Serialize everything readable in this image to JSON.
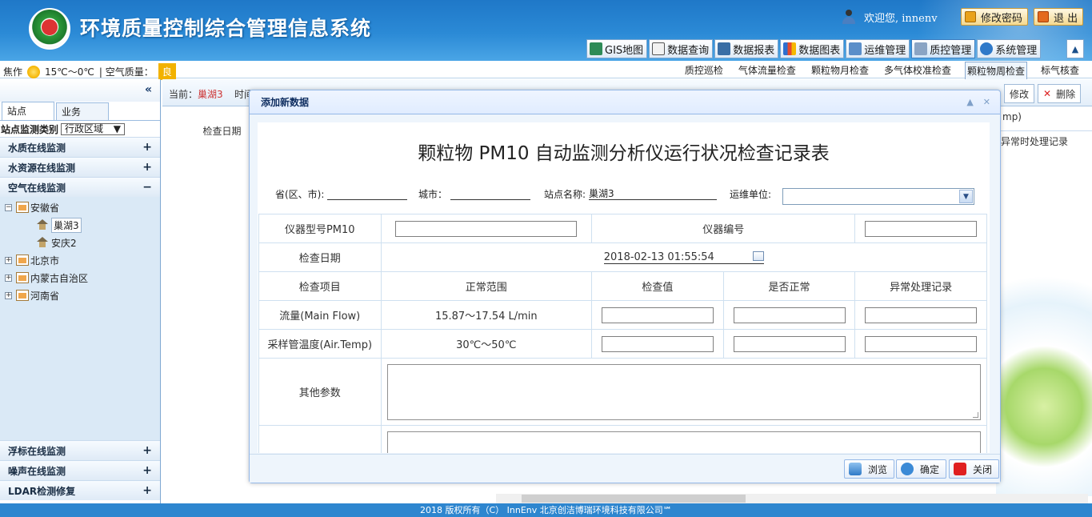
{
  "app": {
    "title": "环境质量控制综合管理信息系统",
    "welcome": "欢迎您, innenv",
    "change_password": "修改密码",
    "logout": "退 出"
  },
  "main_nav": [
    {
      "label": "GIS地图",
      "icon": "map-icon"
    },
    {
      "label": "数据查询",
      "icon": "search-doc-icon"
    },
    {
      "label": "数据报表",
      "icon": "report-icon"
    },
    {
      "label": "数据图表",
      "icon": "chart-icon"
    },
    {
      "label": "运维管理",
      "icon": "maintenance-icon"
    },
    {
      "label": "质控管理",
      "icon": "tools-icon",
      "active": true
    },
    {
      "label": "系统管理",
      "icon": "gear-icon"
    }
  ],
  "weather": {
    "city": "焦作",
    "temp": "15℃～0℃",
    "aq_label": "| 空气质量：",
    "aq_value": "良",
    "aq_color": "#f2b200"
  },
  "sub_nav": [
    "质控巡检",
    "气体流量检查",
    "颗粒物月检查",
    "多气体校准检查",
    "颗粒物周检查",
    "标气核查"
  ],
  "sub_nav_active": "颗粒物周检查",
  "sidebar": {
    "collapse": "«",
    "tabs": [
      "站点",
      "业务"
    ],
    "filter_label": "站点监测类别",
    "filter_value": "行政区域",
    "sections_top": [
      {
        "label": "水质在线监测",
        "sign": "+"
      },
      {
        "label": "水资源在线监测",
        "sign": "+"
      },
      {
        "label": "空气在线监测",
        "sign": "−"
      }
    ],
    "tree": {
      "anhui": "安徽省",
      "chaohu": "巢湖3",
      "anqing": "安庆2",
      "beijing": "北京市",
      "neimenggu": "内蒙古自治区",
      "henan": "河南省"
    },
    "sections_bottom": [
      {
        "label": "浮标在线监测",
        "sign": "+"
      },
      {
        "label": "噪声在线监测",
        "sign": "+"
      },
      {
        "label": "LDAR检测修复",
        "sign": "+"
      }
    ]
  },
  "content": {
    "current_label": "当前：",
    "current_station": "巢湖3",
    "time_label": "时间",
    "edit": "修改",
    "delete": "删除",
    "col_check_date": "检查日期",
    "col_mp": "mp)",
    "col_abnormal": "异常时处理记录"
  },
  "dialog": {
    "title": "添加新数据",
    "form_title": "颗粒物 PM10 自动监测分析仪运行状况检查记录表",
    "province_label": "省(区、市):",
    "city_label": "城市：",
    "station_label": "站点名称:",
    "station_value": "巢湖3",
    "unit_label": "运维单位:",
    "instrument_model_label": "仪器型号PM10",
    "instrument_no_label": "仪器编号",
    "check_date_label": "检查日期",
    "check_date_value": "2018-02-13 01:55:54",
    "headers": [
      "检查项目",
      "正常范围",
      "检查值",
      "是否正常",
      "异常处理记录"
    ],
    "rows": [
      {
        "item": "流量(Main Flow)",
        "range": "15.87～17.54 L/min"
      },
      {
        "item": "采样管温度(Air.Temp)",
        "range": "30℃～50℃"
      }
    ],
    "other_params_label": "其他参数",
    "buttons": {
      "browse": "浏览",
      "ok": "确定",
      "close": "关闭"
    }
  },
  "footer": "2018 版权所有（C） InnEnv 北京创洁博瑞环境科技有限公司℠"
}
